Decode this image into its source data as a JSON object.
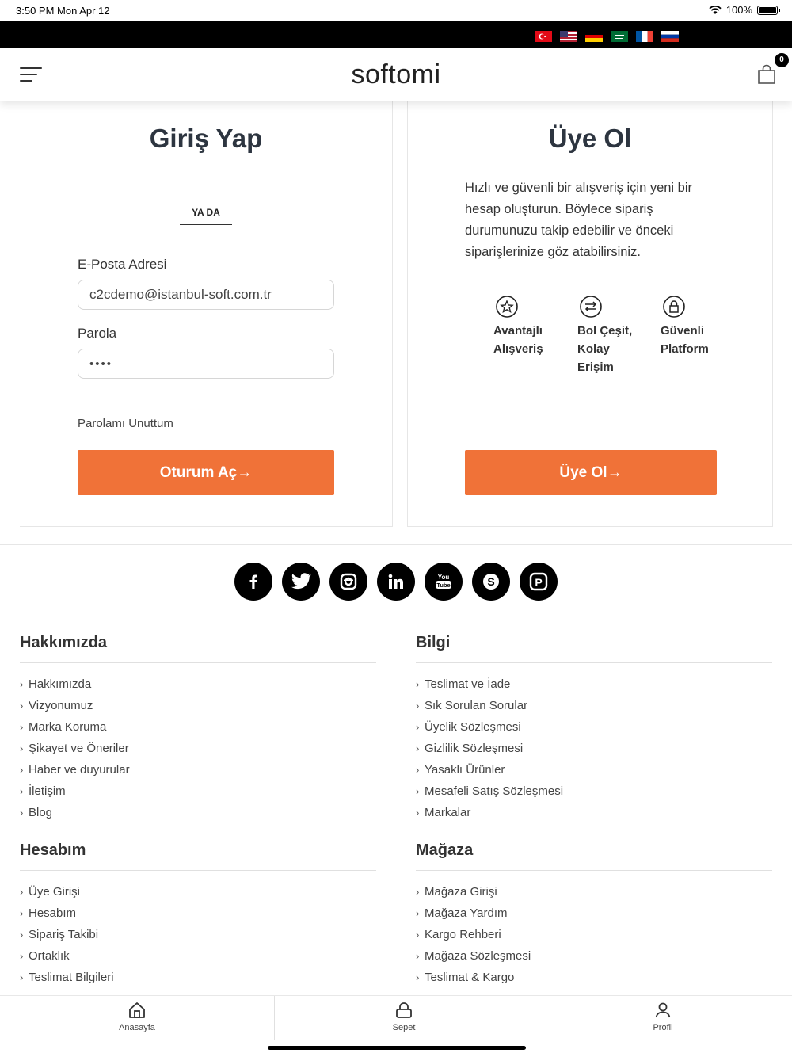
{
  "status_bar": {
    "time": "3:50 PM   Mon Apr 12",
    "battery": "100%"
  },
  "languages": [
    {
      "name": "turkish-flag-icon"
    },
    {
      "name": "us-flag-icon"
    },
    {
      "name": "german-flag-icon"
    },
    {
      "name": "saudi-flag-icon"
    },
    {
      "name": "french-flag-icon"
    },
    {
      "name": "russian-flag-icon"
    }
  ],
  "header": {
    "logo": "softomi",
    "cart_count": "0"
  },
  "login": {
    "title": "Giriş Yap",
    "or_label": "YA DA",
    "email_label": "E-Posta Adresi",
    "email_value": "c2cdemo@istanbul-soft.com.tr",
    "password_label": "Parola",
    "password_value": "••••",
    "forgot_label": "Parolamı Unuttum",
    "submit_label": "Oturum Aç→"
  },
  "register": {
    "title": "Üye Ol",
    "description": "Hızlı ve güvenli bir alışveriş için yeni bir hesap oluşturun. Böylece sipariş durumunuzu takip edebilir ve önceki siparişlerinize göz atabilirsiniz.",
    "features": [
      {
        "label": "Avantajlı Alışveriş",
        "icon": "star-icon"
      },
      {
        "label": "Bol Çeşit, Kolay Erişim",
        "icon": "exchange-icon"
      },
      {
        "label": "Güvenli Platform",
        "icon": "lock-icon"
      }
    ],
    "submit_label": "Üye Ol→"
  },
  "social": [
    "facebook-icon",
    "twitter-icon",
    "instagram-icon",
    "linkedin-icon",
    "youtube-icon",
    "skype-icon",
    "pinterest-icon"
  ],
  "footer": {
    "about": {
      "title": "Hakkımızda",
      "links": [
        "Hakkımızda",
        "Vizyonumuz",
        "Marka Koruma",
        "Şikayet ve Öneriler",
        "Haber ve duyurular",
        "İletişim",
        "Blog"
      ]
    },
    "info": {
      "title": "Bilgi",
      "links": [
        "Teslimat ve İade",
        "Sık Sorulan Sorular",
        "Üyelik Sözleşmesi",
        "Gizlilik Sözleşmesi",
        "Yasaklı Ürünler",
        "Mesafeli Satış Sözleşmesi",
        "Markalar"
      ]
    },
    "account": {
      "title": "Hesabım",
      "links": [
        "Üye Girişi",
        "Hesabım",
        "Sipariş Takibi",
        "Ortaklık",
        "Teslimat Bilgileri"
      ]
    },
    "store": {
      "title": "Mağaza",
      "links": [
        "Mağaza Girişi",
        "Mağaza Yardım",
        "Kargo Rehberi",
        "Mağaza Sözleşmesi",
        "Teslimat & Kargo"
      ]
    }
  },
  "tabbar": {
    "home": "Anasayfa",
    "cart": "Sepet",
    "profile": "Profil"
  },
  "colors": {
    "accent": "#f07238",
    "topbar": "#000000"
  }
}
